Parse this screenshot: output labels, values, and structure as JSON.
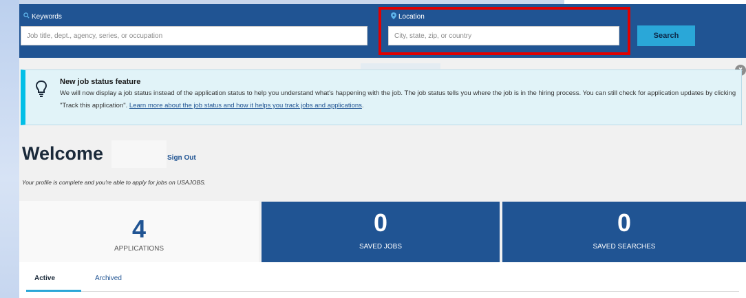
{
  "search": {
    "keywords_label": "Keywords",
    "keywords_placeholder": "Job title, dept., agency, series, or occupation",
    "location_label": "Location",
    "location_placeholder": "City, state, zip, or country",
    "search_button": "Search",
    "search_icon": "search-icon",
    "location_icon": "map-pin-icon"
  },
  "alert": {
    "title": "New job status feature",
    "text_before": "We will now display a job status instead of the application status to help you understand what's happening with the job. The job status tells you where the job is in the hiring process. You can still check for application updates by clicking \"Track this application\". ",
    "link_text": "Learn more about the job status and how it helps you track jobs and applications",
    "text_after": ".",
    "icon": "lightbulb-icon",
    "close_label": "×"
  },
  "welcome": {
    "heading": "Welcome",
    "sign_out": "Sign Out",
    "profile_message": "Your profile is complete and you're able to apply for jobs on USAJOBS."
  },
  "stats": {
    "applications": {
      "count": "4",
      "label": "APPLICATIONS"
    },
    "saved_jobs": {
      "count": "0",
      "label": "SAVED JOBS"
    },
    "saved_searches": {
      "count": "0",
      "label": "SAVED SEARCHES"
    }
  },
  "tabs": {
    "active": "Active",
    "archived": "Archived"
  },
  "colors": {
    "header_blue": "#205493",
    "accent_cyan": "#2aa7d8",
    "highlight_red": "#e00000"
  }
}
